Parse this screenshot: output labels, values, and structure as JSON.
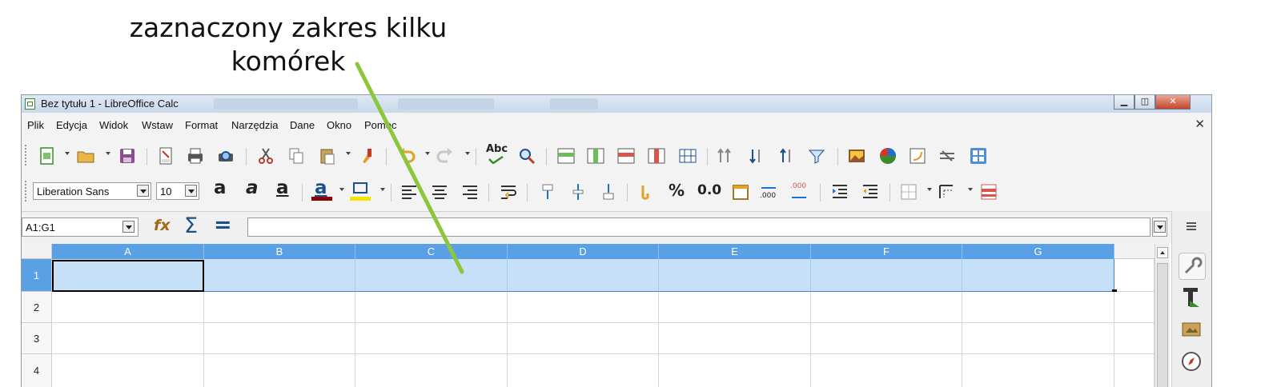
{
  "annotation": {
    "line1": "zaznaczony zakres kilku",
    "line2": "komórek"
  },
  "window": {
    "title": "Bez tytułu 1 - LibreOffice Calc",
    "buttons": [
      "minimize",
      "maximize",
      "close"
    ]
  },
  "menu": {
    "items": [
      "Plik",
      "Edycja",
      "Widok",
      "Wstaw",
      "Format",
      "Narzędzia",
      "Dane",
      "Okno",
      "Pomoc"
    ],
    "close_glyph": "✕"
  },
  "standard_toolbar": {
    "icons": [
      "new-document-icon",
      "open-folder-icon",
      "save-icon",
      "export-pdf-icon",
      "print-icon",
      "print-preview-icon",
      "cut-icon",
      "copy-icon",
      "paste-icon",
      "clone-formatting-icon",
      "undo-icon",
      "redo-icon",
      "spelling-icon",
      "find-replace-icon",
      "row-icon",
      "column-icon",
      "delete-rows-icon",
      "delete-columns-icon",
      "merge-cells-icon",
      "sort-icon",
      "sort-ascending-icon",
      "sort-descending-icon",
      "autofilter-icon",
      "insert-image-icon",
      "insert-chart-icon",
      "pivot-table-icon",
      "special-character-icon",
      "freeze-icon"
    ],
    "spelling_label": "Abc"
  },
  "formatting_toolbar": {
    "font_name": "Liberation Sans",
    "font_size": "10",
    "bold_glyph": "a",
    "italic_glyph": "a",
    "underline_glyph": "a",
    "font_color_glyph": "a",
    "percent_label": "%",
    "decimal_label": "0.0",
    "add_decimal_label": ".000",
    "remove_decimal_label": ".000"
  },
  "formula_bar": {
    "name_box": "A1:G1",
    "function_wizard_glyph": "fx",
    "sum_glyph": "Σ",
    "equals_glyph": "=",
    "input": ""
  },
  "sheet": {
    "columns": [
      "A",
      "B",
      "C",
      "D",
      "E",
      "F",
      "G"
    ],
    "rows": [
      "1",
      "2",
      "3",
      "4"
    ],
    "selection": "A1:G1"
  },
  "colors": {
    "selection_fill": "#c6e0f8",
    "selected_header": "#5aa0e4",
    "pointer_line": "#8bc63e"
  },
  "sidebar": {
    "icons": [
      "properties-icon",
      "styles-icon",
      "gallery-icon",
      "navigator-icon"
    ]
  }
}
